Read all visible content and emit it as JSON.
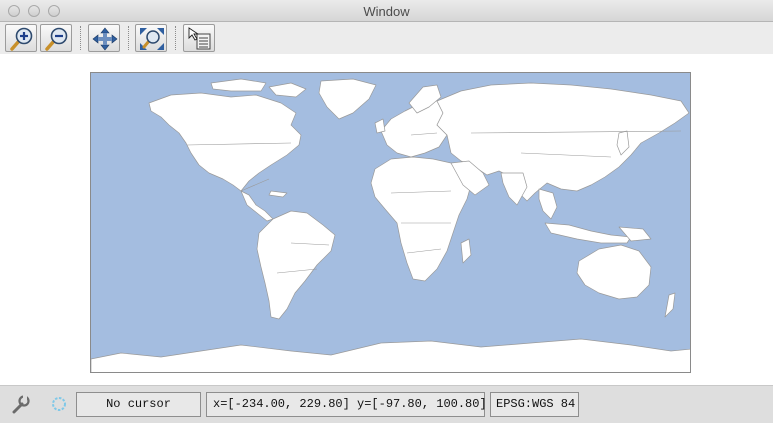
{
  "window": {
    "title": "Window"
  },
  "toolbar": {
    "buttons": [
      {
        "name": "zoom-in-icon"
      },
      {
        "name": "zoom-out-icon"
      },
      {
        "name": "pan-icon"
      },
      {
        "name": "zoom-full-extent-icon"
      },
      {
        "name": "info-select-icon"
      }
    ]
  },
  "map": {
    "ocean_color": "#a4bde0",
    "land_color": "#ffffff",
    "border_color": "#8a8a8a"
  },
  "status": {
    "cursor": "No cursor",
    "extent": "x=[-234.00, 229.80] y=[-97.80, 100.80]",
    "crs": "EPSG:WGS 84"
  }
}
